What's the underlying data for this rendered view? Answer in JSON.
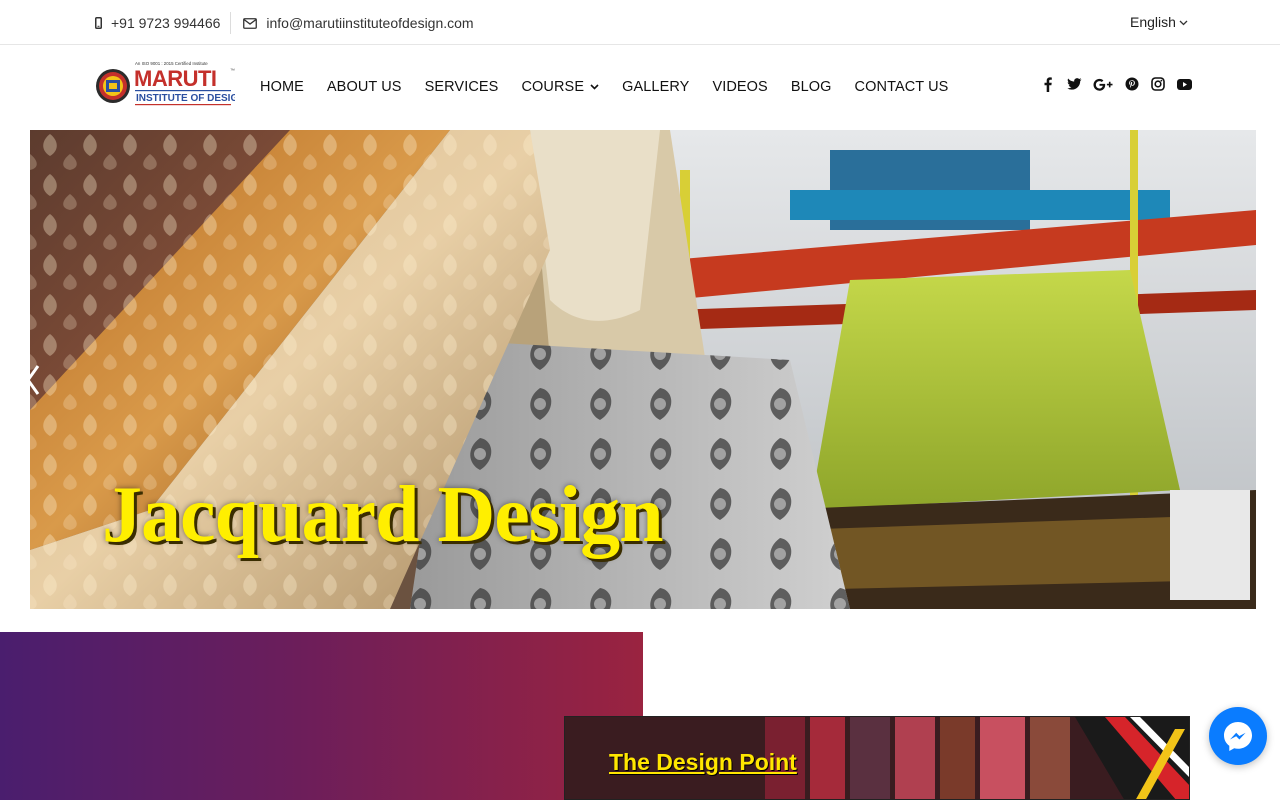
{
  "topbar": {
    "phone": "+91 9723 994466",
    "email": "info@marutiinstituteofdesign.com",
    "language": "English"
  },
  "logo": {
    "brand": "MARUTI",
    "subtitle": "INSTITUTE OF DESIGN",
    "tagline": "An ISO 9001 : 2015 Certified Institute"
  },
  "nav": {
    "items": [
      {
        "label": "HOME"
      },
      {
        "label": "ABOUT US"
      },
      {
        "label": "SERVICES"
      },
      {
        "label": "COURSE",
        "has_dropdown": true
      },
      {
        "label": "GALLERY"
      },
      {
        "label": "VIDEOS"
      },
      {
        "label": "BLOG"
      },
      {
        "label": "CONTACT US"
      }
    ]
  },
  "social": [
    "facebook-icon",
    "twitter-icon",
    "google-plus-icon",
    "pinterest-icon",
    "instagram-icon",
    "youtube-icon"
  ],
  "hero": {
    "title": "Jacquard Design"
  },
  "video": {
    "title": "The Design Point"
  },
  "colors": {
    "accent_yellow": "#ffef00",
    "messenger_blue": "#0a7cff",
    "promo_gradient_start": "#4a1e6e",
    "promo_gradient_end": "#9a2340"
  }
}
